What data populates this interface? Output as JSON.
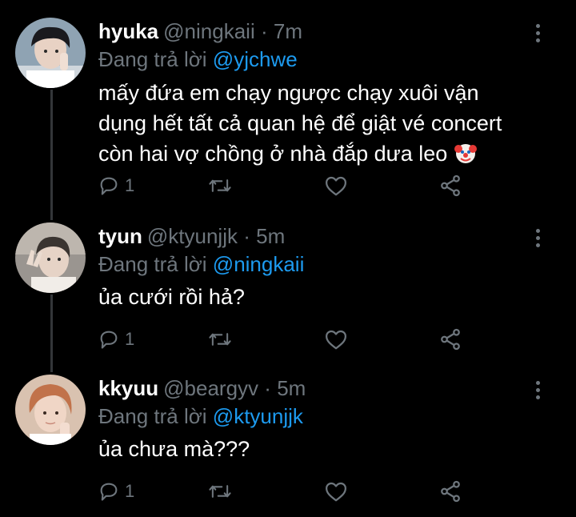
{
  "tweets": [
    {
      "display_name": "hyuka",
      "handle": "@ningkaii",
      "separator": "·",
      "time": "7m",
      "replying_prefix": "Đang trả lời",
      "replying_to": "@yjchwe",
      "text_lines": [
        "mấy đứa em chạy ngược chạy xuôi vận",
        "dụng hết tất cả quan hệ để giật vé concert",
        "còn hai vợ chồng ở nhà đắp dưa leo"
      ],
      "trailing_emoji": "clown-face-emoji",
      "reply_count": "1"
    },
    {
      "display_name": "tyun",
      "handle": "@ktyunjjk",
      "separator": "·",
      "time": "5m",
      "replying_prefix": "Đang trả lời",
      "replying_to": "@ningkaii",
      "text_lines": [
        "ủa cưới rồi hả?"
      ],
      "reply_count": "1"
    },
    {
      "display_name": "kkyuu",
      "handle": "@beargyv",
      "separator": "·",
      "time": "5m",
      "replying_prefix": "Đang trả lời",
      "replying_to": "@ktyunjjk",
      "text_lines": [
        "ủa chưa mà???"
      ],
      "reply_count": "1"
    }
  ],
  "icons": {
    "reply": "reply-icon",
    "retweet": "retweet-icon",
    "like": "heart-icon",
    "share": "share-icon",
    "more": "more-vertical-icon"
  },
  "colors": {
    "background": "#000000",
    "text": "#ffffff",
    "muted": "#6e767d",
    "mention": "#1d9bf0",
    "thread_line": "#333639"
  }
}
